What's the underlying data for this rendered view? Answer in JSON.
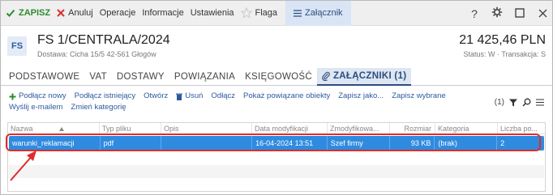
{
  "toolbar": {
    "save": "ZAPISZ",
    "cancel": "Anuluj",
    "operations": "Operacje",
    "info": "Informacje",
    "settings": "Ustawienia",
    "flag": "Flaga",
    "attachment": "Załącznik",
    "help": "?"
  },
  "document": {
    "icon_label": "FS",
    "title": "FS 1/CENTRALA/2024",
    "delivery": "Dostawa: Cicha  15/5  42-561 Głogów",
    "amount": "21 425,46 PLN",
    "status": "Status: W  ·  Transakcja: S"
  },
  "tabs": [
    {
      "label": "PODSTAWOWE"
    },
    {
      "label": "VAT"
    },
    {
      "label": "DOSTAWY"
    },
    {
      "label": "POWIĄZANIA"
    },
    {
      "label": "KSIĘGOWOŚĆ"
    },
    {
      "label": "ZAŁĄCZNIKI (1)"
    }
  ],
  "actions": {
    "add_new": "Podłącz nowy",
    "add_existing": "Podłącz istniejący",
    "open": "Otwórz",
    "delete": "Usuń",
    "detach": "Odłącz",
    "show_related": "Pokaż powiązane obiekty",
    "save_as": "Zapisz jako...",
    "save_selected": "Zapisz wybrane",
    "send_email": "Wyślij e-mailem",
    "change_category": "Zmień kategorię",
    "count": "(1)"
  },
  "grid": {
    "columns": [
      "Nazwa",
      "Typ pliku",
      "Opis",
      "Data modyfikacji",
      "Zmodyfikowa...",
      "Rozmiar",
      "Kategoria",
      "Liczba po..."
    ],
    "rows": [
      {
        "name": "warunki_reklamacji",
        "type": "pdf",
        "description": "",
        "modified": "16-04-2024 13:51",
        "modified_by": "Szef firmy",
        "size": "93 KB",
        "category": "(brak)",
        "count": "2"
      }
    ]
  },
  "colors": {
    "accent": "#2c4d80",
    "selection": "#2f8be0",
    "highlight": "#e02b2b",
    "save": "#2e8b2e"
  }
}
